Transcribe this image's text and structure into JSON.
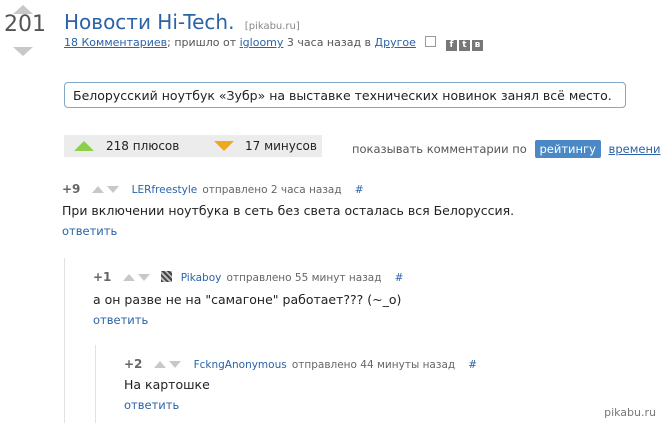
{
  "post": {
    "rating": "201",
    "title": "Новости Hi-Tech.",
    "source": "[pikabu.ru]",
    "comments_link": "18 Комментариев",
    "meta_mid": "; пришло от",
    "author": "igloomy",
    "meta_time": "3 часа назад в",
    "category": "Другое",
    "description": "Белорусский ноутбук «Зубр» на выставке технических новинок занял всё место."
  },
  "votes": {
    "plus_label": "218 плюсов",
    "minus_label": "17 минусов"
  },
  "sort": {
    "prefix": "показывать комментарии по",
    "active": "рейтингу",
    "other": "времени"
  },
  "comments": [
    {
      "score": "+9",
      "user": "LERfreestyle",
      "time": "отправлено 2 часа назад",
      "hash": "#",
      "text": "При включении ноутбука в сеть без света осталась вся Белоруссия.",
      "reply": "ответить"
    },
    {
      "score": "+1",
      "user": "Pikaboy",
      "time": "отправлено 55 минут назад",
      "hash": "#",
      "text": "а он разве не на \"самагоне\" работает??? (~_o)",
      "reply": "ответить"
    },
    {
      "score": "+2",
      "user": "FckngAnonymous",
      "time": "отправлено 44 минуты назад",
      "hash": "#",
      "text": "На картошке",
      "reply": "ответить"
    }
  ],
  "watermark": "pikabu.ru",
  "icons": {
    "save": "save-icon",
    "facebook": "facebook-icon",
    "twitter": "twitter-icon",
    "vk": "vk-icon"
  }
}
